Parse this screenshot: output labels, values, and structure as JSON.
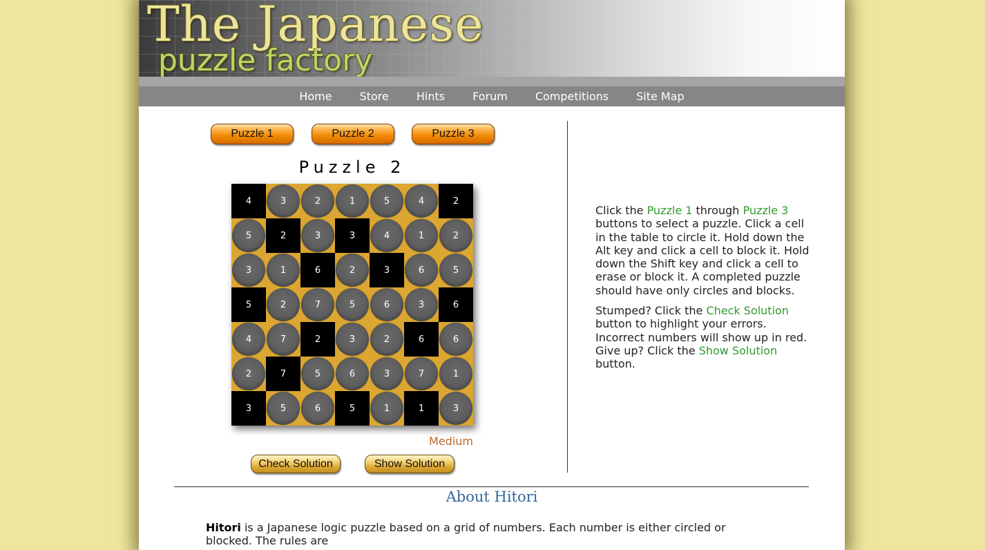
{
  "header": {
    "title_line1": "The Japanese",
    "title_line2": "puzzle factory"
  },
  "nav": {
    "items": [
      "Home",
      "Store",
      "Hints",
      "Forum",
      "Competitions",
      "Site Map"
    ]
  },
  "puzzle_buttons": [
    "Puzzle 1",
    "Puzzle 2",
    "Puzzle 3"
  ],
  "puzzle": {
    "title": "Puzzle 2",
    "difficulty": "Medium",
    "grid": [
      [
        {
          "n": "4",
          "s": "block"
        },
        {
          "n": "3",
          "s": "circle"
        },
        {
          "n": "2",
          "s": "circle"
        },
        {
          "n": "1",
          "s": "circle"
        },
        {
          "n": "5",
          "s": "circle"
        },
        {
          "n": "4",
          "s": "circle"
        },
        {
          "n": "2",
          "s": "block"
        }
      ],
      [
        {
          "n": "5",
          "s": "circle"
        },
        {
          "n": "2",
          "s": "block"
        },
        {
          "n": "3",
          "s": "circle"
        },
        {
          "n": "3",
          "s": "block"
        },
        {
          "n": "4",
          "s": "circle"
        },
        {
          "n": "1",
          "s": "circle"
        },
        {
          "n": "2",
          "s": "circle"
        }
      ],
      [
        {
          "n": "3",
          "s": "circle"
        },
        {
          "n": "1",
          "s": "circle"
        },
        {
          "n": "6",
          "s": "block"
        },
        {
          "n": "2",
          "s": "circle"
        },
        {
          "n": "3",
          "s": "block"
        },
        {
          "n": "6",
          "s": "circle"
        },
        {
          "n": "5",
          "s": "circle"
        }
      ],
      [
        {
          "n": "5",
          "s": "block"
        },
        {
          "n": "2",
          "s": "circle"
        },
        {
          "n": "7",
          "s": "circle"
        },
        {
          "n": "5",
          "s": "circle"
        },
        {
          "n": "6",
          "s": "circle"
        },
        {
          "n": "3",
          "s": "circle"
        },
        {
          "n": "6",
          "s": "block"
        }
      ],
      [
        {
          "n": "4",
          "s": "circle"
        },
        {
          "n": "7",
          "s": "circle"
        },
        {
          "n": "2",
          "s": "block"
        },
        {
          "n": "3",
          "s": "circle"
        },
        {
          "n": "2",
          "s": "circle"
        },
        {
          "n": "6",
          "s": "block"
        },
        {
          "n": "6",
          "s": "circle"
        }
      ],
      [
        {
          "n": "2",
          "s": "circle"
        },
        {
          "n": "7",
          "s": "block"
        },
        {
          "n": "5",
          "s": "circle"
        },
        {
          "n": "6",
          "s": "circle"
        },
        {
          "n": "3",
          "s": "circle"
        },
        {
          "n": "7",
          "s": "circle"
        },
        {
          "n": "1",
          "s": "circle"
        }
      ],
      [
        {
          "n": "3",
          "s": "block"
        },
        {
          "n": "5",
          "s": "circle"
        },
        {
          "n": "6",
          "s": "circle"
        },
        {
          "n": "5",
          "s": "block"
        },
        {
          "n": "1",
          "s": "circle"
        },
        {
          "n": "1",
          "s": "block"
        },
        {
          "n": "3",
          "s": "circle"
        }
      ]
    ]
  },
  "actions": {
    "check": "Check Solution",
    "show": "Show Solution"
  },
  "instructions": {
    "p1": {
      "t1": "Click the ",
      "link1": "Puzzle 1",
      "t2": " through ",
      "link2": "Puzzle 3",
      "t3": " buttons to select a puzzle. Click a cell in the table to circle it. Hold down the Alt key and click a cell to block it. Hold down the Shift key and click a cell to erase or block it. A completed puzzle should have only circles and blocks."
    },
    "p2": {
      "t1": "Stumped? Click the ",
      "link1": "Check Solution",
      "t2": " button to highlight your errors. Incorrect numbers will show up in red. Give up? Click the ",
      "link2": "Show Solution",
      "t3": " button."
    }
  },
  "about": {
    "title": "About Hitori",
    "bold": "Hitori",
    "text": " is a Japanese logic puzzle based on a grid of numbers. Each number is either circled or blocked. The rules are"
  },
  "colors": {
    "page_bg": "#efe59c",
    "board": "#dba631",
    "link_green": "#2f9a2f",
    "difficulty": "#b7682c",
    "about_title": "#336699"
  }
}
